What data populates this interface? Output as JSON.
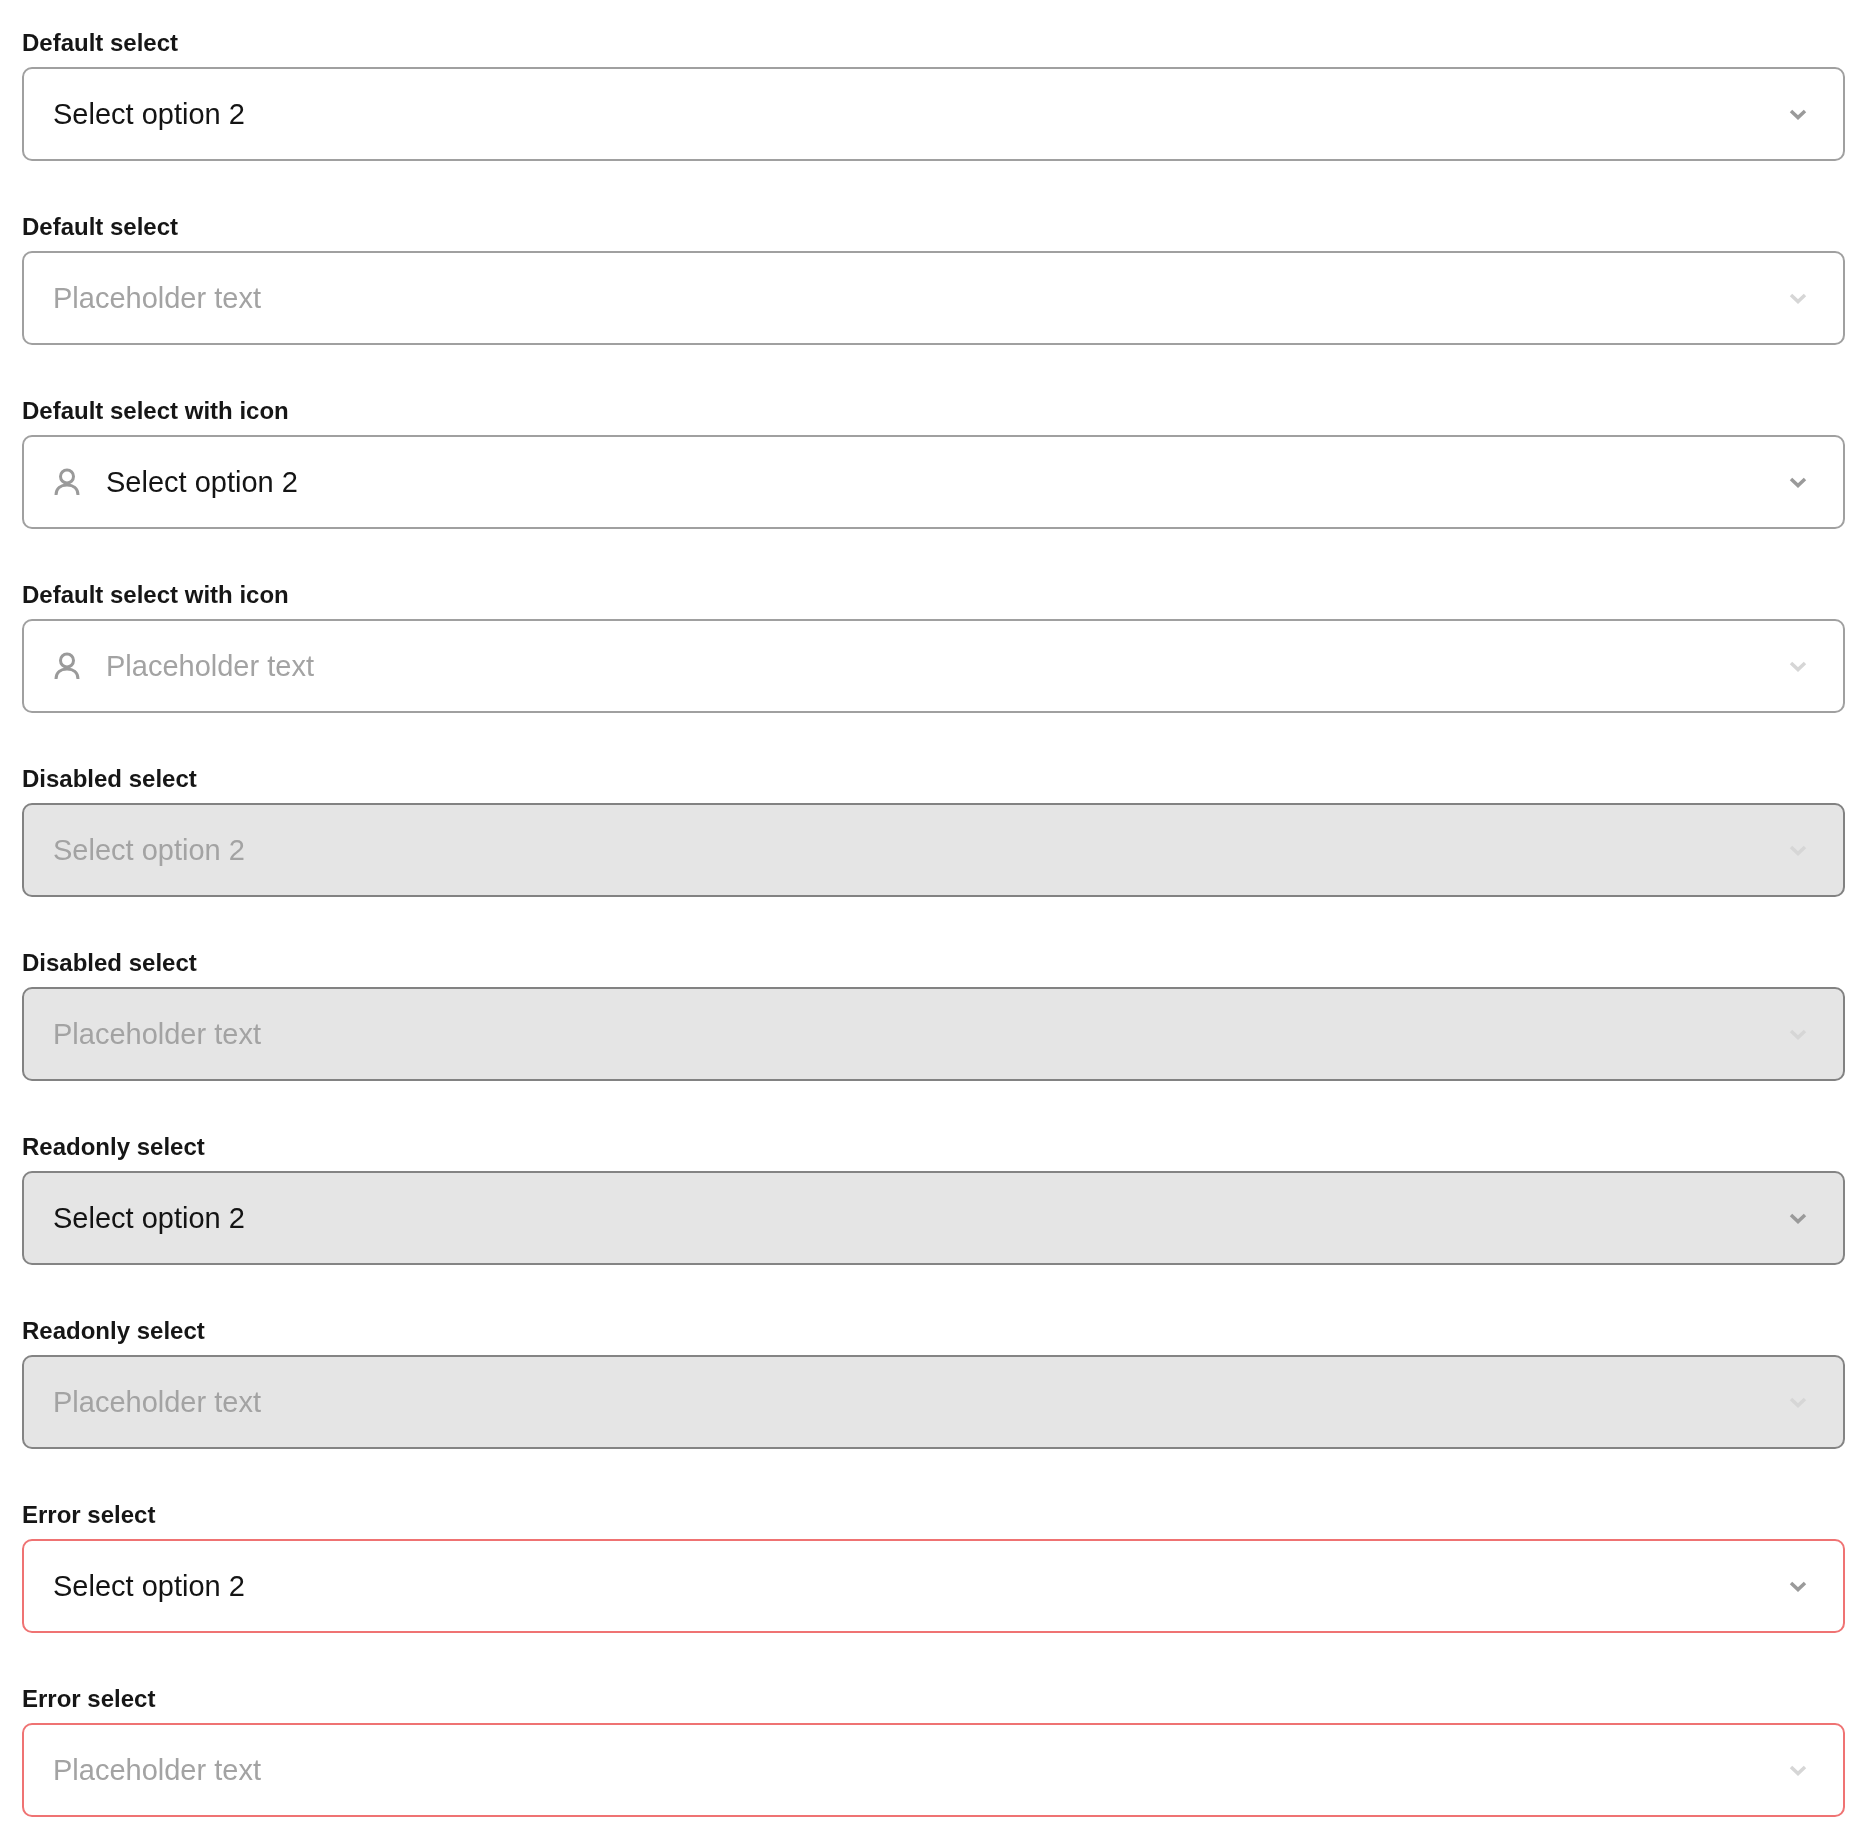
{
  "fields": [
    {
      "label": "Default select",
      "kind": "plain",
      "value": "Select option 2",
      "disabled": false,
      "readonly": false,
      "error": false
    },
    {
      "label": "Default select",
      "kind": "plain",
      "placeholder": "Placeholder text",
      "disabled": false,
      "readonly": false,
      "error": false
    },
    {
      "label": "Default select with icon",
      "kind": "icon",
      "value": "Select option 2",
      "disabled": false,
      "readonly": false,
      "error": false
    },
    {
      "label": "Default select with icon",
      "kind": "icon",
      "placeholder": "Placeholder text",
      "disabled": false,
      "readonly": false,
      "error": false
    },
    {
      "label": "Disabled select",
      "kind": "plain",
      "value": "Select option 2",
      "disabled": true,
      "readonly": false,
      "error": false
    },
    {
      "label": "Disabled select",
      "kind": "plain",
      "placeholder": "Placeholder text",
      "disabled": true,
      "readonly": false,
      "error": false
    },
    {
      "label": "Readonly select",
      "kind": "plain",
      "value": "Select option 2",
      "disabled": false,
      "readonly": true,
      "error": false
    },
    {
      "label": "Readonly select",
      "kind": "plain",
      "placeholder": "Placeholder text",
      "disabled": false,
      "readonly": true,
      "error": false
    },
    {
      "label": "Error select",
      "kind": "plain",
      "value": "Select option 2",
      "disabled": false,
      "readonly": false,
      "error": true
    },
    {
      "label": "Error select",
      "kind": "plain",
      "placeholder": "Placeholder text",
      "disabled": false,
      "readonly": false,
      "error": true
    }
  ]
}
